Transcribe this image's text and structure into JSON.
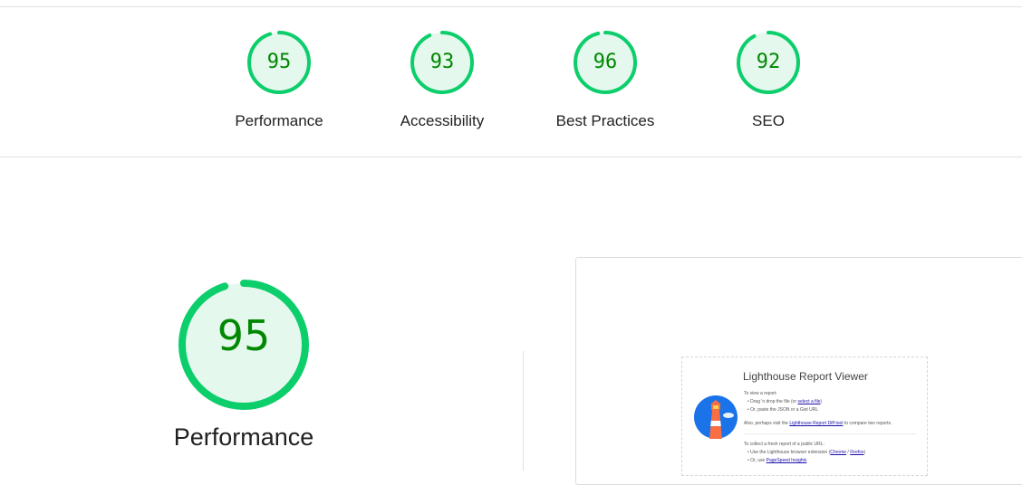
{
  "summary_scores": [
    {
      "label": "Performance",
      "score": "95",
      "value": 95
    },
    {
      "label": "Accessibility",
      "score": "93",
      "value": 93
    },
    {
      "label": "Best Practices",
      "score": "96",
      "value": 96
    },
    {
      "label": "SEO",
      "score": "92",
      "value": 92
    }
  ],
  "main_gauge": {
    "label": "Performance",
    "score": "95",
    "value": 95
  },
  "colors": {
    "pass_stroke": "#0cce6b",
    "pass_fill": "#e5f8ee",
    "pass_text": "#008800"
  },
  "thumbnail": {
    "title": "Lighthouse Report Viewer",
    "view_heading": "To view a report:",
    "drag_prefix": "• Drag 'n drop the file (or ",
    "drag_link": "select a file",
    "drag_suffix": ")",
    "paste_line": "• Or, paste the JSON or a Gist URL",
    "also_prefix": "Also, perhaps visit the ",
    "also_link": "Lighthouse Report Diff tool",
    "also_suffix": " to compare two reports.",
    "collect_heading": "To collect a fresh report of a public URL:",
    "use_prefix": "• Use the Lighthouse browser extension (",
    "chrome_link": "Chrome",
    "slash": " / ",
    "firefox_link": "Firefox",
    "use_suffix": ")",
    "or_use_prefix": "• Or, use ",
    "psi_link": "PageSpeed Insights"
  }
}
